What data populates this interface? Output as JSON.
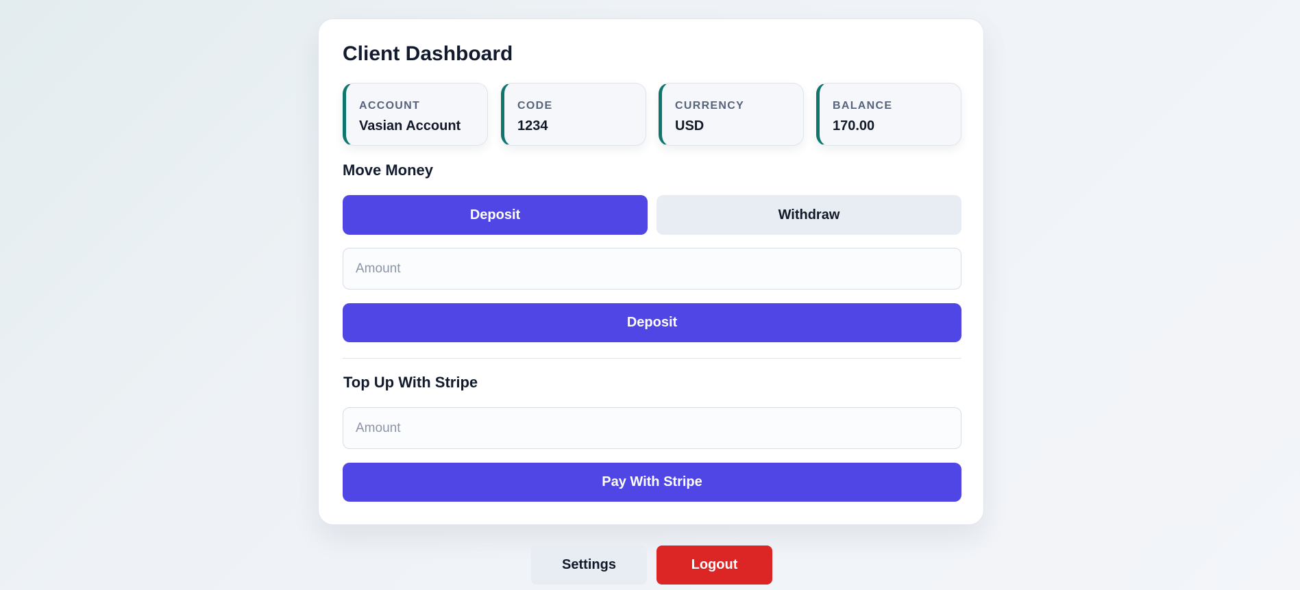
{
  "dashboard": {
    "title": "Client Dashboard",
    "stats": [
      {
        "label": "ACCOUNT",
        "value": "Vasian Account"
      },
      {
        "label": "CODE",
        "value": "1234"
      },
      {
        "label": "CURRENCY",
        "value": "USD"
      },
      {
        "label": "BALANCE",
        "value": "170.00"
      }
    ]
  },
  "move_money": {
    "title": "Move Money",
    "tabs": {
      "deposit": "Deposit",
      "withdraw": "Withdraw",
      "active": "deposit"
    },
    "amount_placeholder": "Amount",
    "amount_value": "",
    "submit_label": "Deposit"
  },
  "stripe": {
    "title": "Top Up With Stripe",
    "amount_placeholder": "Amount",
    "amount_value": "",
    "pay_label": "Pay With Stripe"
  },
  "footer": {
    "settings_label": "Settings",
    "logout_label": "Logout"
  },
  "colors": {
    "primary": "#4f46e5",
    "accent_border": "#0f766e",
    "danger": "#dc2626",
    "neutral_button": "#e8ecf3"
  }
}
